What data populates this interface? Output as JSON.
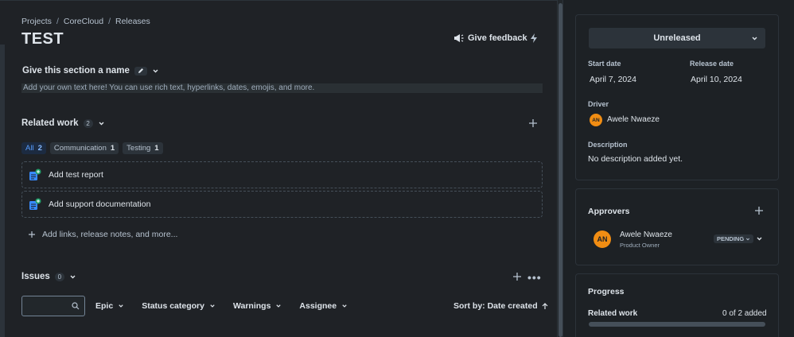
{
  "breadcrumb": [
    "Projects",
    "CoreCloud",
    "Releases"
  ],
  "page": {
    "title": "TEST"
  },
  "header": {
    "feedback_label": "Give feedback"
  },
  "section": {
    "name": "Give this section a name",
    "placeholder": "Add your own text here! You can use rich text, hyperlinks, dates, emojis, and more."
  },
  "related_work": {
    "title": "Related work",
    "count": "2",
    "filters": [
      {
        "label": "All",
        "count": "2",
        "active": true
      },
      {
        "label": "Communication",
        "count": "1",
        "active": false
      },
      {
        "label": "Testing",
        "count": "1",
        "active": false
      }
    ],
    "items": [
      "Add test report",
      "Add support documentation"
    ],
    "add_links": "Add links, release notes, and more..."
  },
  "issues": {
    "title": "Issues",
    "count": "0",
    "filters": [
      "Epic",
      "Status category",
      "Warnings",
      "Assignee"
    ],
    "sort_label": "Sort by: Date created"
  },
  "details": {
    "status": "Unreleased",
    "start_label": "Start date",
    "start_value": "April 7, 2024",
    "release_label": "Release date",
    "release_value": "April 10, 2024",
    "driver_label": "Driver",
    "driver_name": "Awele Nwaeze",
    "driver_initials": "AN",
    "description_label": "Description",
    "description_value": "No description added yet."
  },
  "approvers": {
    "title": "Approvers",
    "name": "Awele Nwaeze",
    "role": "Product Owner",
    "initials": "AN",
    "status": "PENDING"
  },
  "progress": {
    "title": "Progress",
    "related_label": "Related work",
    "related_value": "0 of 2 added",
    "fraction": 0
  },
  "colors": {
    "accent": "#579dff",
    "avatar": "#f18d13",
    "background": "#1d2125"
  }
}
